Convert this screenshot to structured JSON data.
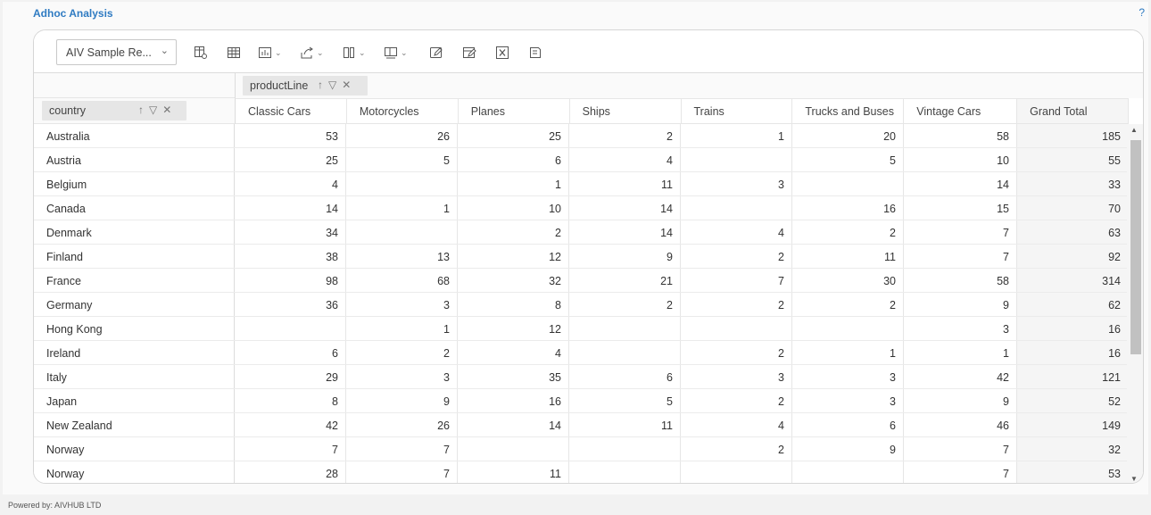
{
  "app": {
    "title": "Adhoc Analysis",
    "help": "?"
  },
  "toolbar": {
    "report_select": "AIV Sample Re...",
    "icons": [
      "table-settings-icon",
      "table-icon",
      "chart-icon",
      "export-icon",
      "columns-icon",
      "layout-icon",
      "edit-icon",
      "edit-alt-icon",
      "excel-icon",
      "save-icon"
    ]
  },
  "pivot": {
    "column_field": "productLine",
    "row_field": "country",
    "columns": [
      "Classic Cars",
      "Motorcycles",
      "Planes",
      "Ships",
      "Trains",
      "Trucks and Buses",
      "Vintage Cars",
      "Grand Total"
    ],
    "rows": [
      {
        "label": "Australia",
        "values": [
          "53",
          "26",
          "25",
          "2",
          "1",
          "20",
          "58",
          "185"
        ]
      },
      {
        "label": "Austria",
        "values": [
          "25",
          "5",
          "6",
          "4",
          "",
          "5",
          "10",
          "55"
        ]
      },
      {
        "label": "Belgium",
        "values": [
          "4",
          "",
          "1",
          "11",
          "3",
          "",
          "14",
          "33"
        ]
      },
      {
        "label": "Canada",
        "values": [
          "14",
          "1",
          "10",
          "14",
          "",
          "16",
          "15",
          "70"
        ]
      },
      {
        "label": "Denmark",
        "values": [
          "34",
          "",
          "2",
          "14",
          "4",
          "2",
          "7",
          "63"
        ]
      },
      {
        "label": "Finland",
        "values": [
          "38",
          "13",
          "12",
          "9",
          "2",
          "11",
          "7",
          "92"
        ]
      },
      {
        "label": "France",
        "values": [
          "98",
          "68",
          "32",
          "21",
          "7",
          "30",
          "58",
          "314"
        ]
      },
      {
        "label": "Germany",
        "values": [
          "36",
          "3",
          "8",
          "2",
          "2",
          "2",
          "9",
          "62"
        ]
      },
      {
        "label": "Hong Kong",
        "values": [
          "",
          "1",
          "12",
          "",
          "",
          "",
          "3",
          "16"
        ]
      },
      {
        "label": "Ireland",
        "values": [
          "6",
          "2",
          "4",
          "",
          "2",
          "1",
          "1",
          "16"
        ]
      },
      {
        "label": "Italy",
        "values": [
          "29",
          "3",
          "35",
          "6",
          "3",
          "3",
          "42",
          "121"
        ]
      },
      {
        "label": "Japan",
        "values": [
          "8",
          "9",
          "16",
          "5",
          "2",
          "3",
          "9",
          "52"
        ]
      },
      {
        "label": "New Zealand",
        "values": [
          "42",
          "26",
          "14",
          "11",
          "4",
          "6",
          "46",
          "149"
        ]
      },
      {
        "label": "Norway",
        "values": [
          "7",
          "7",
          "",
          "",
          "2",
          "9",
          "7",
          "32"
        ]
      },
      {
        "label": "Norway",
        "values": [
          "28",
          "7",
          "11",
          "",
          "",
          "",
          "7",
          "53"
        ]
      }
    ]
  },
  "footer": {
    "powered_by": "Powered by: AIVHUB LTD"
  }
}
